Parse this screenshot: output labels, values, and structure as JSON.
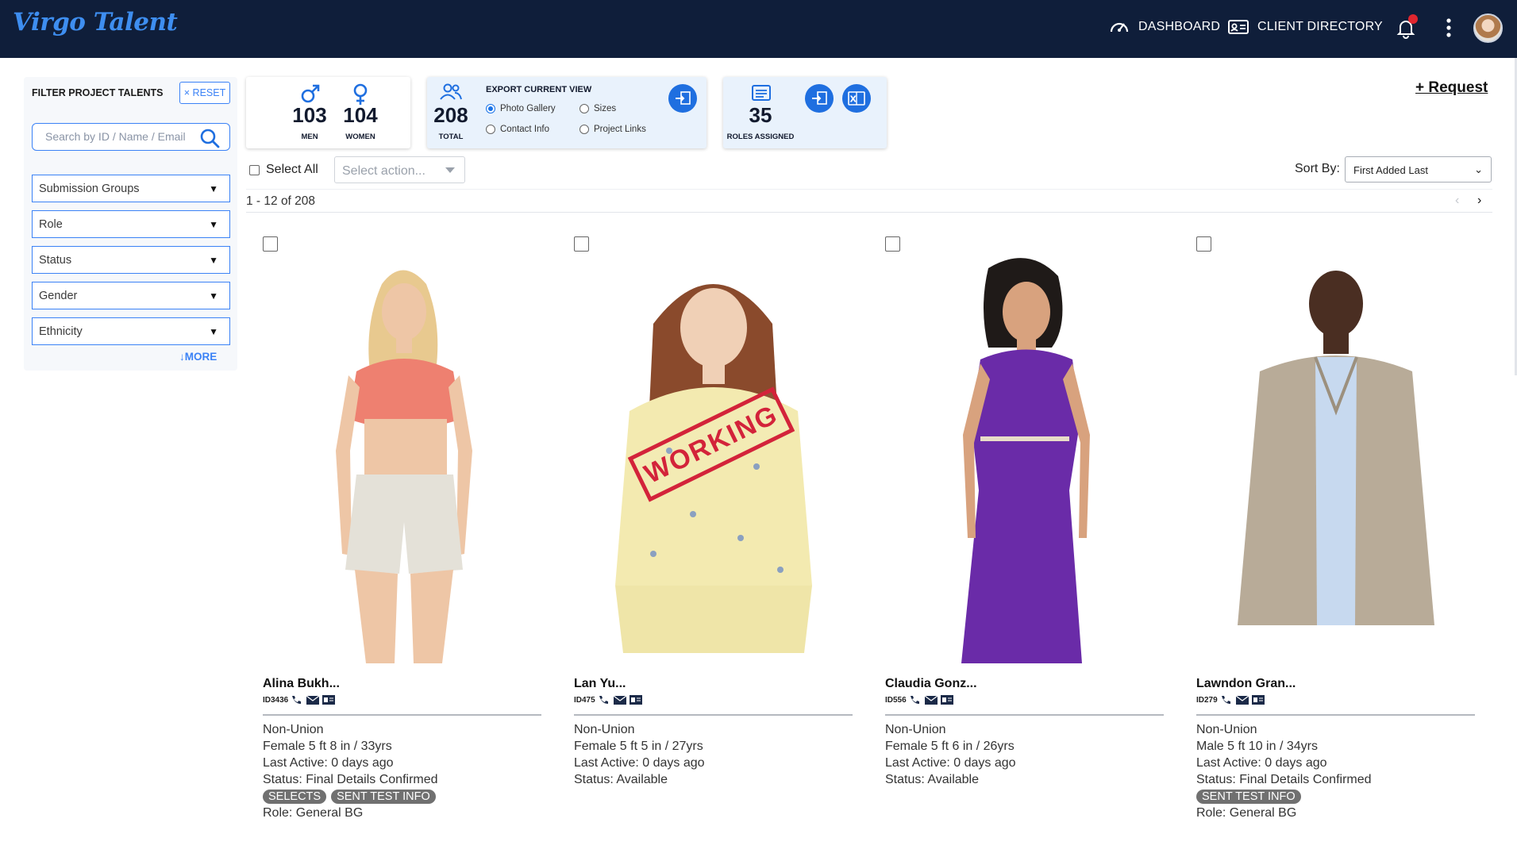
{
  "brand": {
    "logo": "Virgo Talent"
  },
  "nav": {
    "dashboard": "DASHBOARD",
    "client_directory": "CLIENT DIRECTORY"
  },
  "filter": {
    "title": "FILTER PROJECT TALENTS",
    "reset": "× RESET",
    "search_placeholder": "Search by ID / Name / Email",
    "dropdowns": [
      "Submission Groups",
      "Role",
      "Status",
      "Gender",
      "Ethnicity"
    ],
    "more": "MORE"
  },
  "stats": {
    "men": {
      "value": "103",
      "label": "MEN"
    },
    "women": {
      "value": "104",
      "label": "WOMEN"
    },
    "total": {
      "value": "208",
      "label": "TOTAL"
    },
    "roles": {
      "value": "35",
      "label": "ROLES ASSIGNED"
    }
  },
  "export": {
    "title": "EXPORT CURRENT VIEW",
    "options": [
      "Photo Gallery",
      "Sizes",
      "Contact Info",
      "Project Links"
    ],
    "selected": "Photo Gallery"
  },
  "request": "+ Request",
  "toolbar": {
    "select_all": "Select All",
    "action_placeholder": "Select action...",
    "sort_label": "Sort By:",
    "sort_value": "First Added Last",
    "range": "1 - 12 of 208",
    "prev": "‹",
    "next": "›"
  },
  "stamp": "WORKING",
  "talents": [
    {
      "name": "Alina Bukh...",
      "id": "ID3436",
      "union": "Non-Union",
      "details": "Female 5 ft 8 in / 33yrs",
      "last_active": "Last Active: 0 days ago",
      "status": "Status: Final Details Confirmed",
      "badges": [
        "SELECTS",
        "SENT TEST INFO"
      ],
      "role": "Role: General BG"
    },
    {
      "name": "Lan Yu...",
      "id": "ID475",
      "union": "Non-Union",
      "details": "Female 5 ft 5 in / 27yrs",
      "last_active": "Last Active: 0 days ago",
      "status": "Status: Available",
      "badges": [],
      "role": ""
    },
    {
      "name": "Claudia Gonz...",
      "id": "ID556",
      "union": "Non-Union",
      "details": "Female 5 ft 6 in / 26yrs",
      "last_active": "Last Active: 0 days ago",
      "status": "Status: Available",
      "badges": [],
      "role": ""
    },
    {
      "name": "Lawndon Gran...",
      "id": "ID279",
      "union": "Non-Union",
      "details": "Male 5 ft 10 in / 34yrs",
      "last_active": "Last Active: 0 days ago",
      "status": "Status: Final Details Confirmed",
      "badges": [
        "SENT TEST INFO"
      ],
      "role": "Role: General BG"
    }
  ],
  "colors": {
    "topbar": "#0f1e3a",
    "accent": "#3b82f6",
    "badge": "#707070",
    "stamp": "#d3233a"
  }
}
